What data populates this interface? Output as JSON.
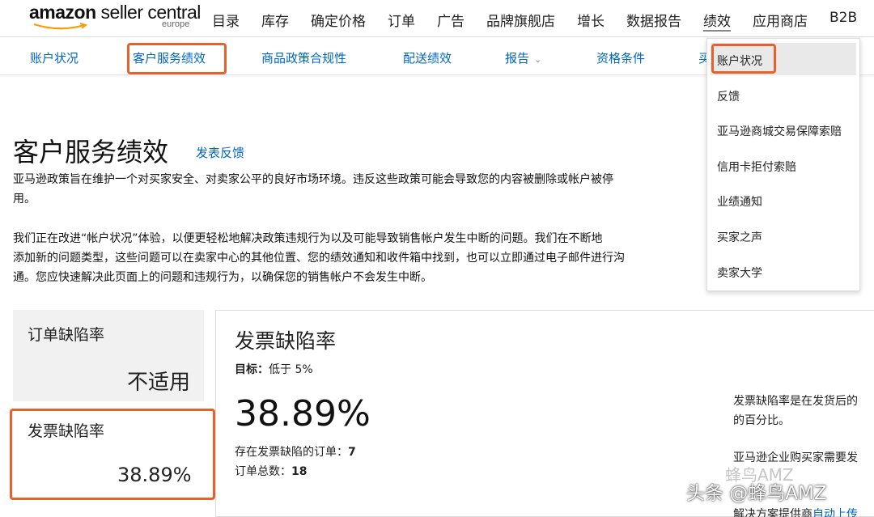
{
  "logo": {
    "brand_bold": "amazon",
    "brand_rest": " seller central",
    "region": "europe"
  },
  "topnav": {
    "items": [
      "目录",
      "库存",
      "确定价格",
      "订单",
      "广告",
      "品牌旗舰店",
      "增长",
      "数据报告",
      "绩效",
      "应用商店",
      "B2B"
    ],
    "active": "绩效"
  },
  "subnav": {
    "items": [
      {
        "label": "账户状况"
      },
      {
        "label": "客户服务绩效"
      },
      {
        "label": "商品政策合规性"
      },
      {
        "label": "配送绩效"
      },
      {
        "label": "报告"
      },
      {
        "label": "资格条件"
      },
      {
        "label": "买"
      }
    ],
    "highlighted": "客户服务绩效"
  },
  "dropdown": {
    "items": [
      "账户状况",
      "反馈",
      "亚马逊商城交易保障索赔",
      "信用卡拒付索赔",
      "业绩通知",
      "买家之声",
      "卖家大学"
    ],
    "highlighted": "账户状况"
  },
  "page": {
    "title": "客户服务绩效",
    "feedback_link": "发表反馈",
    "paragraphs": [
      "亚马逊政策旨在维护一个对买家安全、对卖家公平的良好市场环境。违反这些政策可能会导致您的内容被删除或帐户被停",
      "用。",
      "我们正在改进“帐户状况”体验，以便更轻松地解决政策违规行为以及可能导致销售帐户发生中断的问题。我们在不断地",
      "添加新的问题类型，这些问题可以在卖家中心的其他位置、您的绩效通知和收件箱中找到，也可以立即通过电子邮件进行沟",
      "通。您应快速解决此页面上的问题和违规行为，以确保您的销售帐户不会发生中断。"
    ]
  },
  "metrics_sidebar": {
    "order_defect": {
      "label": "订单缺陷率",
      "value": "不适用"
    },
    "invoice_defect": {
      "label": "发票缺陷率",
      "value": "38.89%"
    }
  },
  "panel": {
    "title": "发票缺陷率",
    "target_label": "目标：",
    "target_value": "低于 5%",
    "big_value": "38.89%",
    "defect_orders_label": "存在发票缺陷的订单：",
    "defect_orders_value": "7",
    "total_orders_label": "订单总数：",
    "total_orders_value": "18",
    "side_lines": [
      "发票缺陷率是在发货后的",
      "的百分比。",
      "亚马逊企业购买家需要发",
      "解决方案提供商",
      "自动上传"
    ]
  },
  "watermark": {
    "line1": "蜂鸟AMZ",
    "line2": "头条 @蜂鸟AMZ"
  },
  "colors": {
    "link": "#0066c0",
    "highlight": "#e8612c",
    "card_bg": "#f1f1f1"
  }
}
